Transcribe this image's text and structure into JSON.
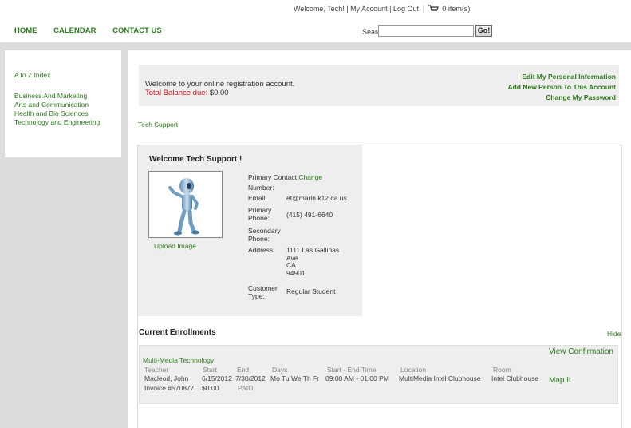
{
  "header": {
    "welcome": "Welcome, Tech!",
    "my_account": "My Account",
    "log_out": "Log Out",
    "cart": "0 item(s)",
    "sep": "|"
  },
  "nav": [
    "HOME",
    "CALENDAR",
    "CONTACT US"
  ],
  "search": {
    "label": "Search",
    "value": "",
    "button": "Go!"
  },
  "sidebar": {
    "index": "A to Z Index",
    "items": [
      "Business And Marketing",
      "Arts and Communication",
      "Health and Bio Sciences",
      "Technology and Engineering"
    ]
  },
  "account": {
    "welcome": "Welcome to your online registration account.",
    "balance_label": "Total Balance due:",
    "balance_value": "$0.00",
    "links": [
      "Edit My Personal Information",
      "Add New Person To This Account",
      "Change My Password"
    ]
  },
  "user_link": "Tech Support",
  "profile": {
    "title": "Welcome Tech Support !",
    "upload": "Upload Image",
    "primary_contact_label": "Primary Contact",
    "change": "Change",
    "number_label": "Number:",
    "email_label": "Email:",
    "email": "et@marin.k12.ca.us",
    "primary_phone_label1": "Primary",
    "primary_phone_label2": "Phone:",
    "primary_phone": "(415) 491-6640",
    "secondary_phone_label1": "Secondary",
    "secondary_phone_label2": "Phone:",
    "address_label": "Address:",
    "address_lines": [
      "1111 Las Gallinas",
      "Ave",
      "CA",
      "94901"
    ],
    "customer_type_label1": "Customer",
    "customer_type_label2": "Type:",
    "customer_type": "Regular Student"
  },
  "enrollments": {
    "title": "Current Enrollments",
    "hide": "Hide",
    "course": "Multi-Media Technology",
    "headers": [
      "Teacher",
      "Start",
      "End",
      "Days",
      "Start - End Time",
      "Location",
      "Room"
    ],
    "row": [
      "Macleod, John",
      "6/15/2012",
      "7/30/2012",
      "Mo Tu We Th Fr",
      "09:00 AM - 01:00 PM",
      "MultiMedia Intel Clubhouse",
      "Intel Clubhouse"
    ],
    "invoice": "Invoice #570877",
    "amount": "$0.00",
    "status": "PAID",
    "view_confirmation": "View Confirmation",
    "map_it": "Map It"
  }
}
